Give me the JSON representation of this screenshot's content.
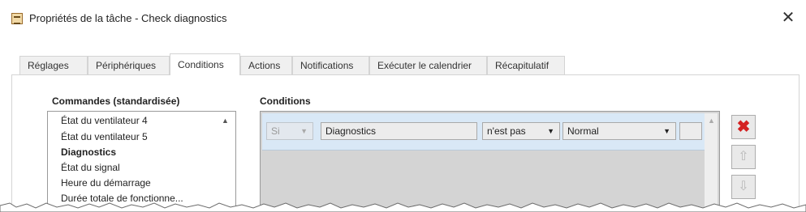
{
  "window": {
    "title": "Propriétés de la tâche - Check diagnostics",
    "close_glyph": "✕",
    "app_icon": "task-properties-icon"
  },
  "tabs": [
    {
      "label": "Réglages"
    },
    {
      "label": "Périphériques"
    },
    {
      "label": "Conditions"
    },
    {
      "label": "Actions"
    },
    {
      "label": "Notifications"
    },
    {
      "label": "Exécuter le calendrier"
    },
    {
      "label": "Récapitulatif"
    }
  ],
  "active_tab": "Conditions",
  "commands": {
    "title": "Commandes (standardisée)",
    "items": [
      {
        "label": "État du ventilateur 4"
      },
      {
        "label": "État du ventilateur 5"
      },
      {
        "label": "Diagnostics"
      },
      {
        "label": "État du signal"
      },
      {
        "label": "Heure du démarrage"
      },
      {
        "label": "Durée totale de fonctionne..."
      }
    ],
    "selected": "Diagnostics"
  },
  "conditions": {
    "title": "Conditions",
    "row": {
      "prefix": "Si",
      "field": "Diagnostics",
      "operator": "n'est pas",
      "value": "Normal"
    }
  },
  "buttons": {
    "delete_glyph": "✖",
    "up_glyph": "⇧",
    "down_glyph": "⇩"
  },
  "colors": {
    "selected_row": "#d9e8f6",
    "delete": "#d42020"
  }
}
